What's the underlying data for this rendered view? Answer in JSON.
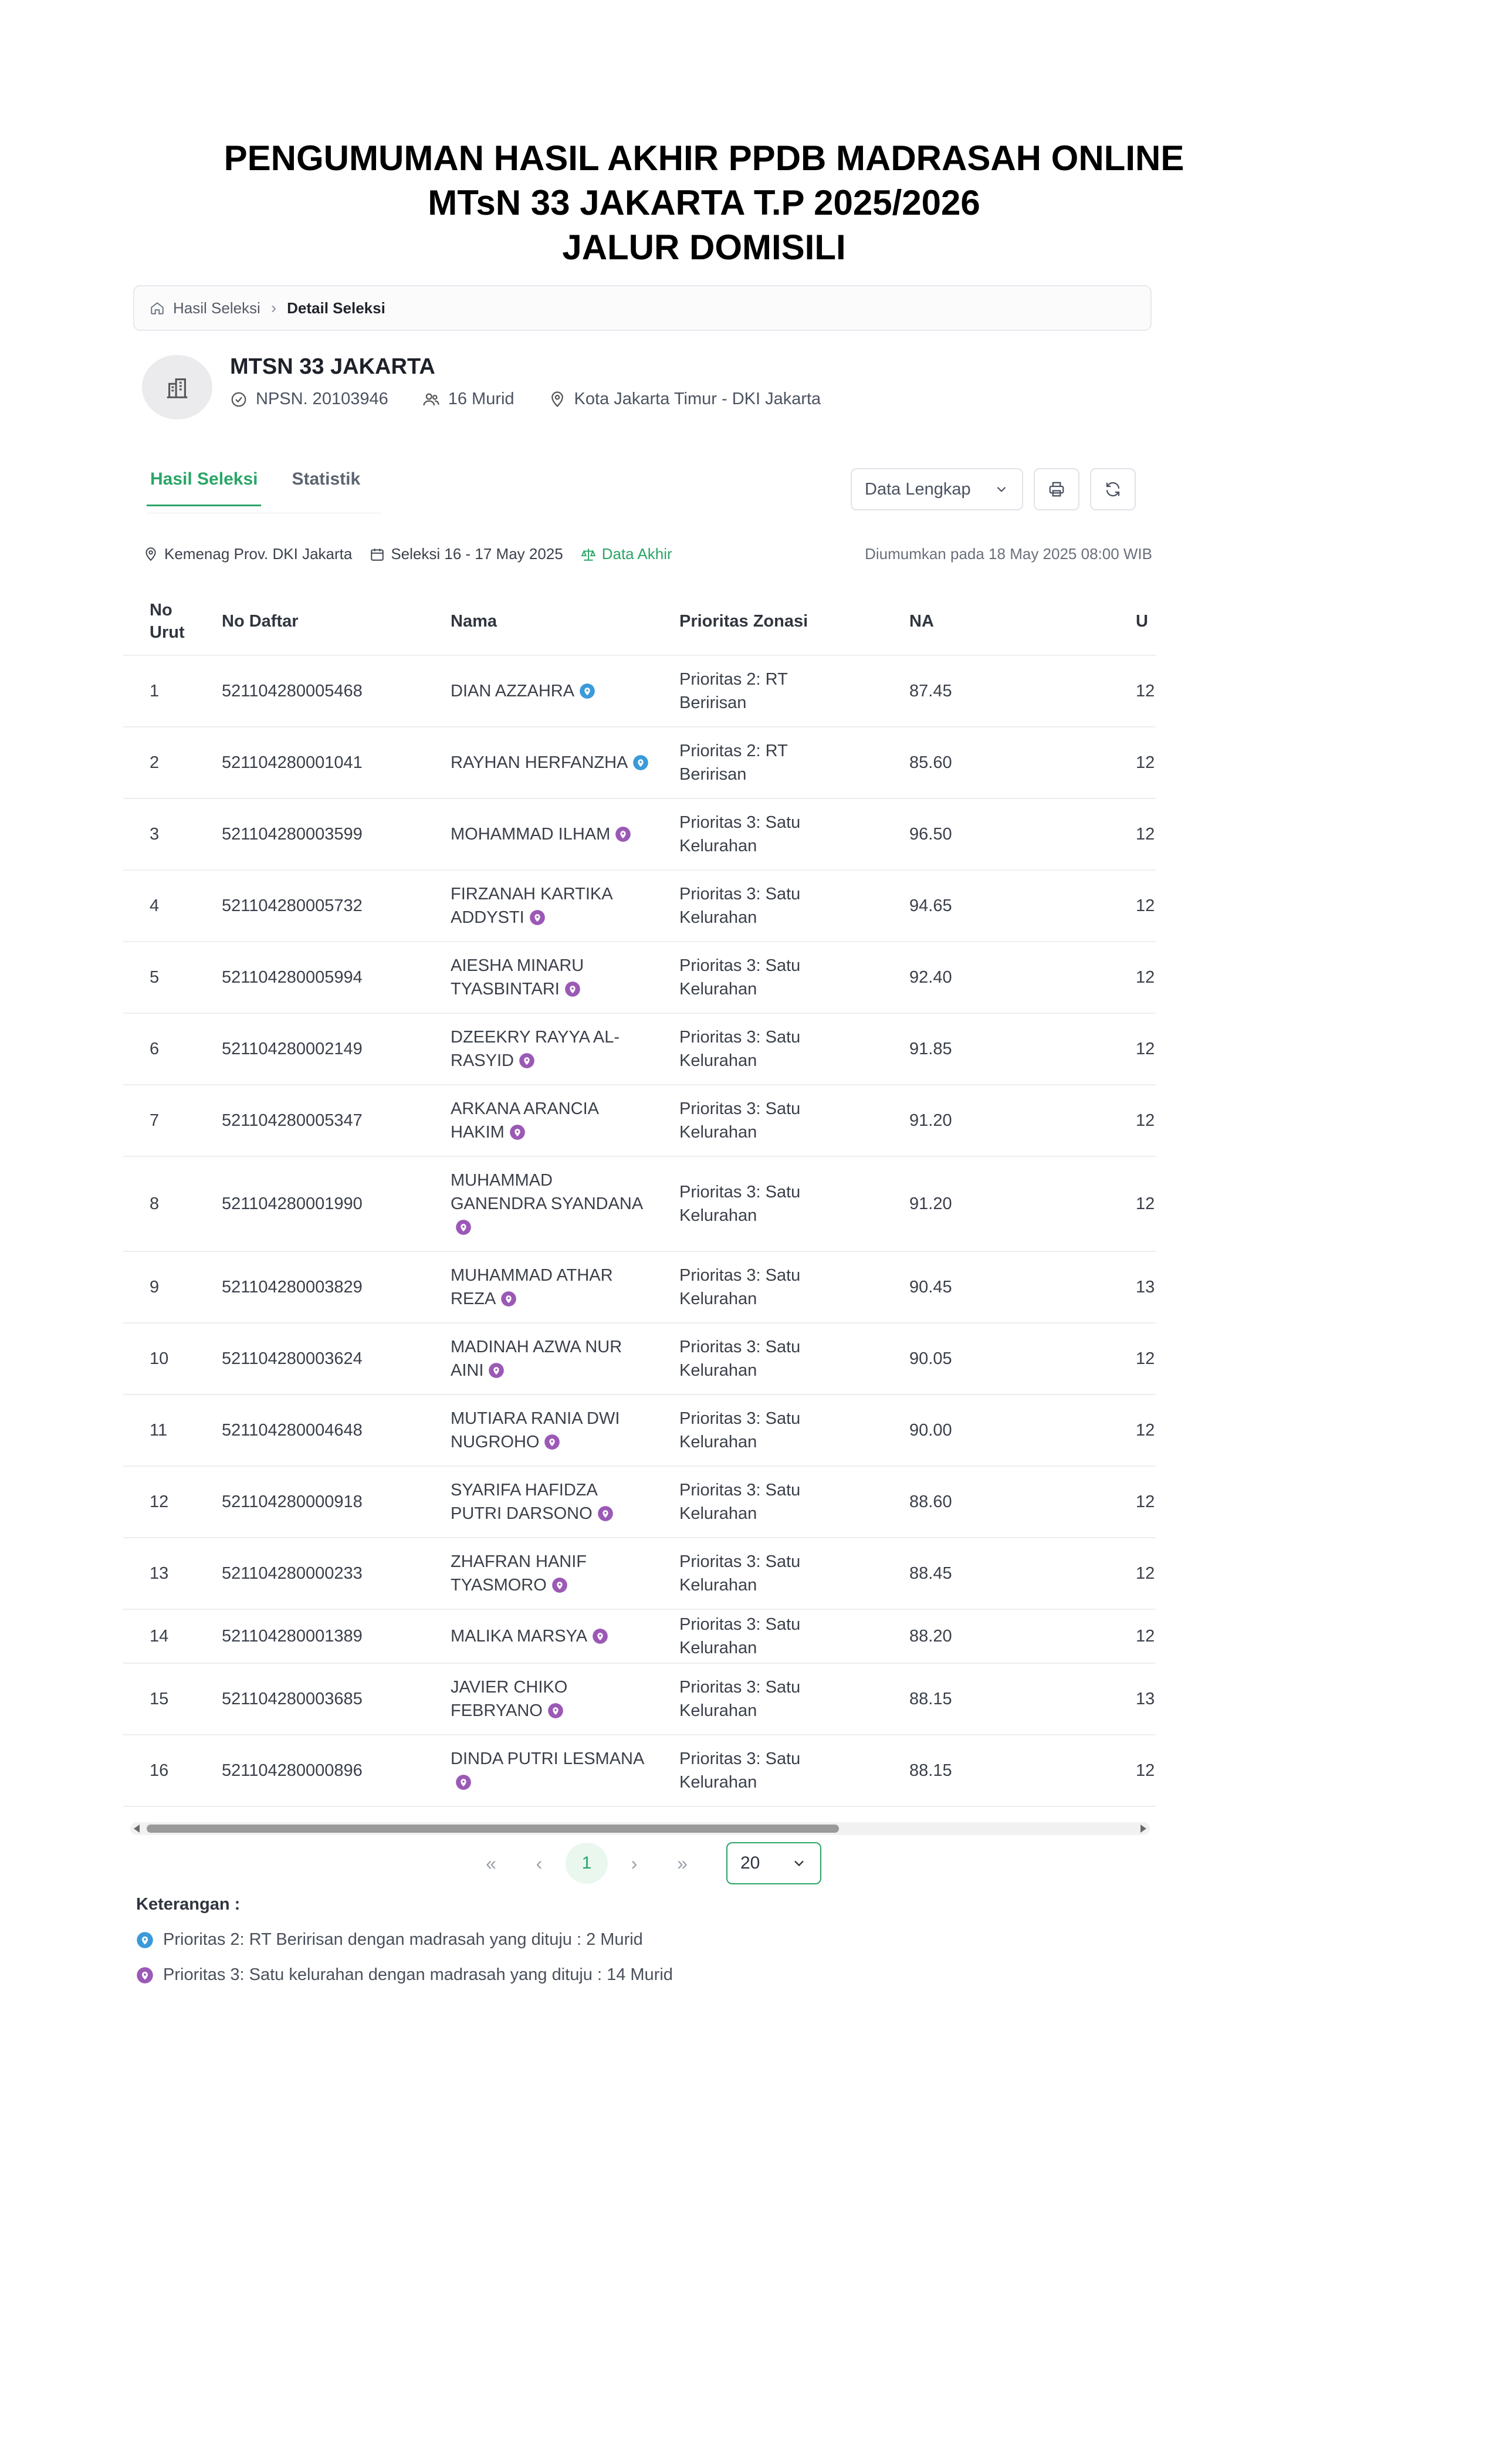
{
  "headline": {
    "line1": "PENGUMUMAN HASIL AKHIR PPDB MADRASAH ONLINE",
    "line2": "MTsN 33 JAKARTA T.P 2025/2026",
    "line3": "JALUR DOMISILI"
  },
  "breadcrumb": {
    "home": "Hasil Seleksi",
    "current": "Detail Seleksi"
  },
  "school": {
    "name": "MTSN 33 JAKARTA",
    "npsn": "NPSN. 20103946",
    "students": "16 Murid",
    "location": "Kota Jakarta Timur - DKI Jakarta"
  },
  "tabs": [
    {
      "label": "Hasil Seleksi",
      "active": true
    },
    {
      "label": "Statistik",
      "active": false
    }
  ],
  "toolbar": {
    "data_select": "Data Lengkap"
  },
  "info": {
    "office": "Kemenag Prov. DKI Jakarta",
    "selection": "Seleksi 16 - 17 May 2025",
    "status": "Data Akhir",
    "announced": "Diumumkan pada 18 May 2025 08:00 WIB"
  },
  "table": {
    "headers": {
      "no": "No\nUrut",
      "daftar": "No Daftar",
      "nama": "Nama",
      "prioritas": "Prioritas Zonasi",
      "na": "NA",
      "us": "U"
    },
    "rows": [
      {
        "no": "1",
        "daftar": "521104280005468",
        "nama": "DIAN AZZAHRA",
        "prio": "Prioritas 2: RT Beririsan",
        "p": 2,
        "na": "87.45",
        "us": "12"
      },
      {
        "no": "2",
        "daftar": "521104280001041",
        "nama": "RAYHAN HERFANZHA",
        "prio": "Prioritas 2: RT Beririsan",
        "p": 2,
        "na": "85.60",
        "us": "12"
      },
      {
        "no": "3",
        "daftar": "521104280003599",
        "nama": "MOHAMMAD ILHAM",
        "prio": "Prioritas 3: Satu Kelurahan",
        "p": 3,
        "na": "96.50",
        "us": "12"
      },
      {
        "no": "4",
        "daftar": "521104280005732",
        "nama": "FIRZANAH KARTIKA ADDYSTI",
        "prio": "Prioritas 3: Satu Kelurahan",
        "p": 3,
        "na": "94.65",
        "us": "12"
      },
      {
        "no": "5",
        "daftar": "521104280005994",
        "nama": "AIESHA MINARU TYASBINTARI",
        "prio": "Prioritas 3: Satu Kelurahan",
        "p": 3,
        "na": "92.40",
        "us": "12"
      },
      {
        "no": "6",
        "daftar": "521104280002149",
        "nama": "DZEEKRY RAYYA AL-RASYID",
        "prio": "Prioritas 3: Satu Kelurahan",
        "p": 3,
        "na": "91.85",
        "us": "12"
      },
      {
        "no": "7",
        "daftar": "521104280005347",
        "nama": "ARKANA ARANCIA HAKIM",
        "prio": "Prioritas 3: Satu Kelurahan",
        "p": 3,
        "na": "91.20",
        "us": "12"
      },
      {
        "no": "8",
        "daftar": "521104280001990",
        "nama": "MUHAMMAD GANENDRA SYANDANA",
        "prio": "Prioritas 3: Satu Kelurahan",
        "p": 3,
        "na": "91.20",
        "us": "12"
      },
      {
        "no": "9",
        "daftar": "521104280003829",
        "nama": "MUHAMMAD ATHAR REZA",
        "prio": "Prioritas 3: Satu Kelurahan",
        "p": 3,
        "na": "90.45",
        "us": "13"
      },
      {
        "no": "10",
        "daftar": "521104280003624",
        "nama": "MADINAH AZWA NUR AINI",
        "prio": "Prioritas 3: Satu Kelurahan",
        "p": 3,
        "na": "90.05",
        "us": "12"
      },
      {
        "no": "11",
        "daftar": "521104280004648",
        "nama": "MUTIARA RANIA DWI NUGROHO",
        "prio": "Prioritas 3: Satu Kelurahan",
        "p": 3,
        "na": "90.00",
        "us": "12"
      },
      {
        "no": "12",
        "daftar": "521104280000918",
        "nama": "SYARIFA HAFIDZA PUTRI DARSONO",
        "prio": "Prioritas 3: Satu Kelurahan",
        "p": 3,
        "na": "88.60",
        "us": "12"
      },
      {
        "no": "13",
        "daftar": "521104280000233",
        "nama": "ZHAFRAN HANIF TYASMORO",
        "prio": "Prioritas 3: Satu Kelurahan",
        "p": 3,
        "na": "88.45",
        "us": "12"
      },
      {
        "no": "14",
        "daftar": "521104280001389",
        "nama": "MALIKA MARSYA",
        "prio": "Prioritas 3: Satu Kelurahan",
        "p": 3,
        "na": "88.20",
        "us": "12"
      },
      {
        "no": "15",
        "daftar": "521104280003685",
        "nama": "JAVIER CHIKO FEBRYANO",
        "prio": "Prioritas 3: Satu Kelurahan",
        "p": 3,
        "na": "88.15",
        "us": "13"
      },
      {
        "no": "16",
        "daftar": "521104280000896",
        "nama": "DINDA PUTRI LESMANA",
        "prio": "Prioritas 3: Satu Kelurahan",
        "p": 3,
        "na": "88.15",
        "us": "12"
      }
    ]
  },
  "pagination": {
    "current": "1",
    "page_size": "20"
  },
  "legend": {
    "title": "Keterangan :",
    "items": [
      {
        "text": "Prioritas 2: RT Beririsan dengan madrasah yang dituju : 2 Murid",
        "color": "#3b9ad9"
      },
      {
        "text": "Prioritas 3: Satu kelurahan dengan madrasah yang dituju : 14 Murid",
        "color": "#9b59b6"
      }
    ]
  },
  "colors": {
    "accent": "#2aa567",
    "prio2": "#3b9ad9",
    "prio3": "#9b59b6"
  }
}
